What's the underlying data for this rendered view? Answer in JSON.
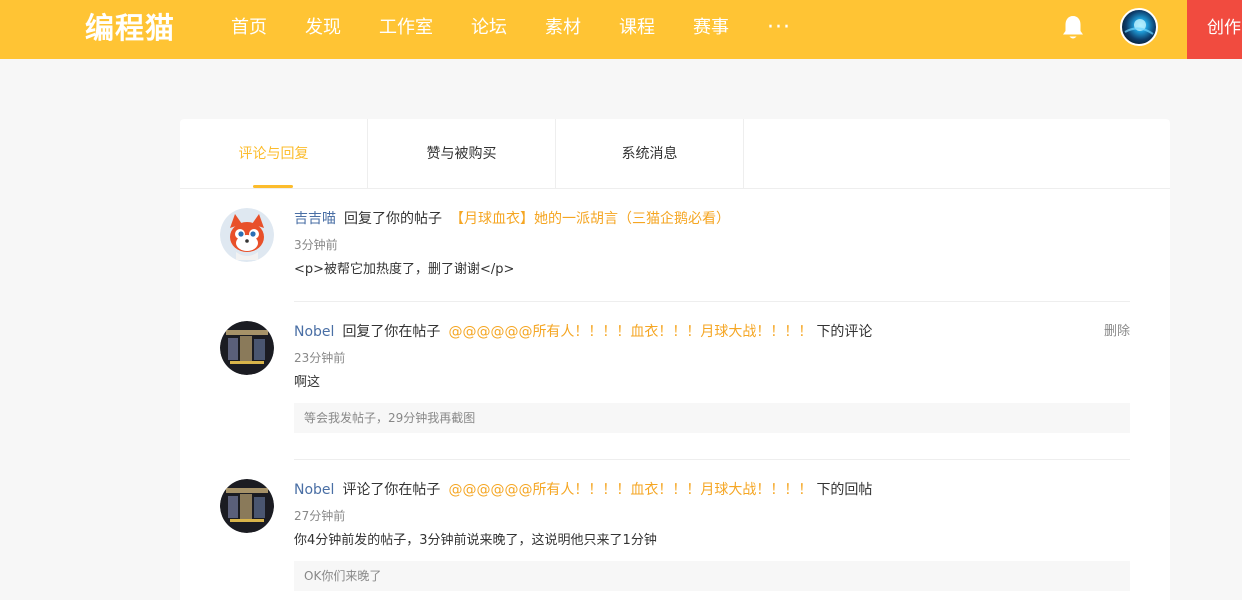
{
  "header": {
    "logo": "编程猫",
    "nav": [
      "首页",
      "发现",
      "工作室",
      "论坛",
      "素材",
      "课程",
      "赛事"
    ],
    "more": "···",
    "create_label": "创作",
    "accent_color": "#ffc434"
  },
  "tabs": [
    {
      "label": "评论与回复",
      "active": true
    },
    {
      "label": "赞与被购买",
      "active": false
    },
    {
      "label": "系统消息",
      "active": false
    }
  ],
  "notifications": [
    {
      "user": "吉吉喵",
      "action": "回复了你的帖子",
      "post": "【月球血衣】她的一派胡言（三猫企鹅必看）",
      "suffix": "",
      "time": "3分钟前",
      "text": "<p>被帮它加热度了，删了谢谢</p>",
      "quote": ""
    },
    {
      "user": "Nobel",
      "action": "回复了你在帖子",
      "post": "@@@@@@所有人！！！！血衣！！！月球大战！！！！",
      "suffix": "下的评论",
      "time": "23分钟前",
      "text": "啊这",
      "quote": "等会我发帖子，29分钟我再截图",
      "delete_label": "删除"
    },
    {
      "user": "Nobel",
      "action": "评论了你在帖子",
      "post": "@@@@@@所有人！！！！血衣！！！月球大战！！！！",
      "suffix": "下的回帖",
      "time": "27分钟前",
      "text": "你4分钟前发的帖子，3分钟前说来晚了，这说明他只来了1分钟",
      "quote": "OK你们来晚了"
    }
  ]
}
